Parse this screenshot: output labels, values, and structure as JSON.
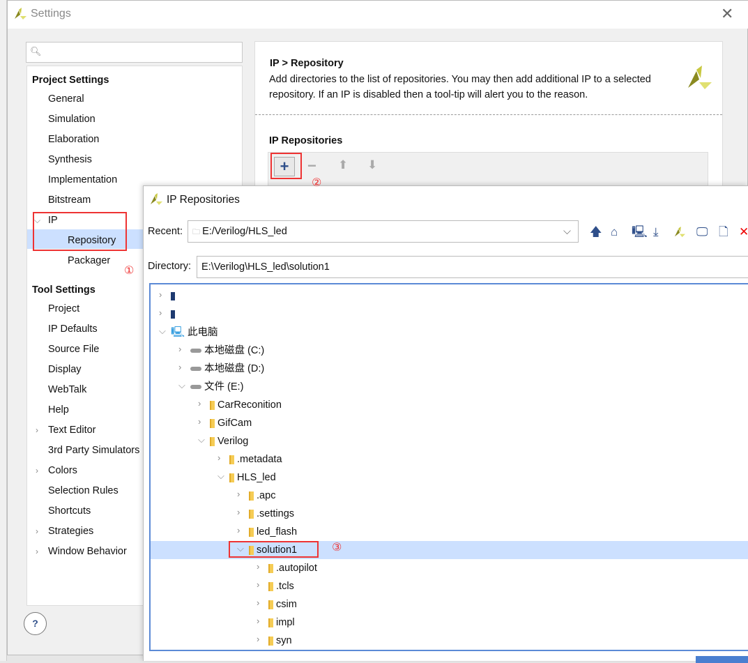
{
  "settings": {
    "title": "Settings",
    "close_icon": "close-icon",
    "search_placeholder": "",
    "project_header": "Project Settings",
    "project_items": [
      {
        "label": "General"
      },
      {
        "label": "Simulation"
      },
      {
        "label": "Elaboration"
      },
      {
        "label": "Synthesis"
      },
      {
        "label": "Implementation"
      },
      {
        "label": "Bitstream"
      },
      {
        "label": "IP",
        "expanded": true
      },
      {
        "label": "Repository",
        "selected": true,
        "child": true
      },
      {
        "label": "Packager",
        "child": true
      }
    ],
    "tool_header": "Tool Settings",
    "tool_items": [
      {
        "label": "Project"
      },
      {
        "label": "IP Defaults"
      },
      {
        "label": "Source File"
      },
      {
        "label": "Display"
      },
      {
        "label": "WebTalk"
      },
      {
        "label": "Help"
      },
      {
        "label": "Text Editor",
        "collapsed": true
      },
      {
        "label": "3rd Party Simulators"
      },
      {
        "label": "Colors",
        "collapsed": true
      },
      {
        "label": "Selection Rules"
      },
      {
        "label": "Shortcuts"
      },
      {
        "label": "Strategies",
        "collapsed": true
      },
      {
        "label": "Window Behavior",
        "collapsed": true
      }
    ],
    "help_label": "?",
    "panel": {
      "breadcrumb": "IP > Repository",
      "desc1": "Add directories to the list of repositories. You may then add additional IP to a selected",
      "desc2": "repository. If an IP is disabled then a tool-tip will alert you to the reason.",
      "section": "IP Repositories"
    }
  },
  "annotations": {
    "a1": "①",
    "a2": "②",
    "a3": "③",
    "color": "#ee3333"
  },
  "repo_dialog": {
    "title": "IP Repositories",
    "recent_label": "Recent:",
    "recent_value": "E:/Verilog/HLS_led",
    "directory_label": "Directory:",
    "directory_value": "E:\\Verilog\\HLS_led\\solution1",
    "toolbar": [
      "arrow-up-icon",
      "home-icon",
      "network-desktop-icon",
      "download-icon",
      "vivado-logo-icon",
      "desktop-icon",
      "new-file-icon",
      "delete-icon"
    ],
    "tree": [
      {
        "label": "",
        "level": 0,
        "icon": "drive",
        "open": false
      },
      {
        "label": "",
        "level": 0,
        "icon": "drive",
        "open": false
      },
      {
        "label": "此电脑",
        "level": 0,
        "icon": "pc",
        "open": true
      },
      {
        "label": "本地磁盘 (C:)",
        "level": 1,
        "icon": "disk",
        "open": false
      },
      {
        "label": "本地磁盘 (D:)",
        "level": 1,
        "icon": "disk",
        "open": false
      },
      {
        "label": "文件 (E:)",
        "level": 1,
        "icon": "disk",
        "open": true
      },
      {
        "label": "CarReconition",
        "level": 2,
        "icon": "folder",
        "open": false
      },
      {
        "label": "GifCam",
        "level": 2,
        "icon": "folder",
        "open": false
      },
      {
        "label": "Verilog",
        "level": 2,
        "icon": "folder",
        "open": true
      },
      {
        "label": ".metadata",
        "level": 3,
        "icon": "folder",
        "open": false
      },
      {
        "label": "HLS_led",
        "level": 3,
        "icon": "folder",
        "open": true
      },
      {
        "label": ".apc",
        "level": 4,
        "icon": "folder",
        "open": false
      },
      {
        "label": ".settings",
        "level": 4,
        "icon": "folder",
        "open": false
      },
      {
        "label": "led_flash",
        "level": 4,
        "icon": "folder",
        "open": false
      },
      {
        "label": "solution1",
        "level": 4,
        "icon": "folder",
        "open": true,
        "selected": true
      },
      {
        "label": ".autopilot",
        "level": 5,
        "icon": "folder",
        "open": false
      },
      {
        "label": ".tcls",
        "level": 5,
        "icon": "folder",
        "open": false
      },
      {
        "label": "csim",
        "level": 5,
        "icon": "folder",
        "open": false
      },
      {
        "label": "impl",
        "level": 5,
        "icon": "folder",
        "open": false
      },
      {
        "label": "syn",
        "level": 5,
        "icon": "folder",
        "open": false
      }
    ]
  }
}
